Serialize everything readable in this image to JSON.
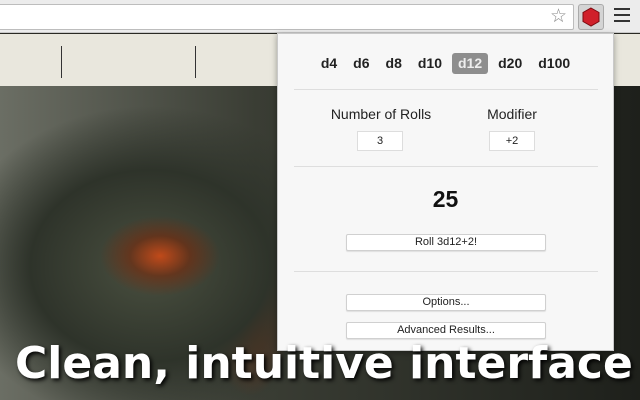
{
  "browser": {
    "bookmark_icon": "star-icon",
    "extension_icon": "red-d20-icon",
    "menu_icon": "hamburger-icon"
  },
  "popup": {
    "dice": [
      {
        "label": "d4"
      },
      {
        "label": "d6"
      },
      {
        "label": "d8"
      },
      {
        "label": "d10"
      },
      {
        "label": "d12",
        "selected": true
      },
      {
        "label": "d20"
      },
      {
        "label": "d100"
      }
    ],
    "rolls_label": "Number of Rolls",
    "rolls_value": "3",
    "modifier_label": "Modifier",
    "modifier_value": "+2",
    "result": "25",
    "roll_button": "Roll 3d12+2!",
    "options_button": "Options...",
    "advanced_button": "Advanced Results..."
  },
  "caption": "Clean, intuitive interface",
  "colors": {
    "selected_die": "#8e8e8e",
    "extension_red": "#d0202a"
  }
}
